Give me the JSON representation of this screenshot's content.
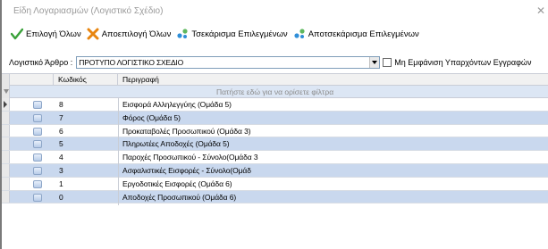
{
  "window": {
    "title": "Είδη Λογαριασμών (Λογιστικό Σχέδιο)",
    "close_glyph": "✕"
  },
  "toolbar": {
    "select_all": "Επιλογή Όλων",
    "deselect_all": "Αποεπιλογή Όλων",
    "check_selected": "Τσεκάρισμα Επιλεγμένων",
    "uncheck_selected": "Αποτσεκάρισμα Επιλεγμένων"
  },
  "filter": {
    "label": "Λογιστικό Άρθρο :",
    "selected_value": "ΠΡΟΤΥΠΟ ΛΟΓΙΣΤΙΚΟ ΣΧΕΔΙΟ",
    "hide_existing_label": "Μη Εμφάνιση Υπαρχόντων Εγγραφών"
  },
  "grid": {
    "columns": [
      "Κωδικός",
      "Περιγραφή"
    ],
    "filter_hint": "Πατήστε εδώ για να ορίσετε φίλτρα",
    "rows": [
      {
        "code": "8",
        "description": "Εισφορά Αλληλεγγύης (Ομάδα 5)"
      },
      {
        "code": "7",
        "description": "Φόρος (Ομάδα 5)"
      },
      {
        "code": "6",
        "description": "Προκαταβολές Προσωπικού (Ομάδα 3)"
      },
      {
        "code": "5",
        "description": "Πληρωτέες Αποδοχές (Ομάδα 5)"
      },
      {
        "code": "4",
        "description": "Παροχές Προσωπικού - Σύνολο(Ομάδα 3"
      },
      {
        "code": "3",
        "description": "Ασφαλιστικές Εισφορές - Σύνολο(Ομάδ"
      },
      {
        "code": "1",
        "description": "Εργοδοτικές Εισφορές (Ομάδα 6)"
      },
      {
        "code": "0",
        "description": "Αποδοχές Προσωπικού (Ομάδα 6)"
      }
    ]
  },
  "icons": {
    "select_all": "check-icon",
    "deselect_all": "cross-icon",
    "check_selected": "tick-nodes-icon",
    "uncheck_selected": "untick-nodes-icon"
  },
  "colors": {
    "alt_row": "#c9d8ee",
    "filter_hint_bg": "#dce6f4",
    "check_green": "#3aa13a",
    "cross_orange": "#e8850f"
  }
}
